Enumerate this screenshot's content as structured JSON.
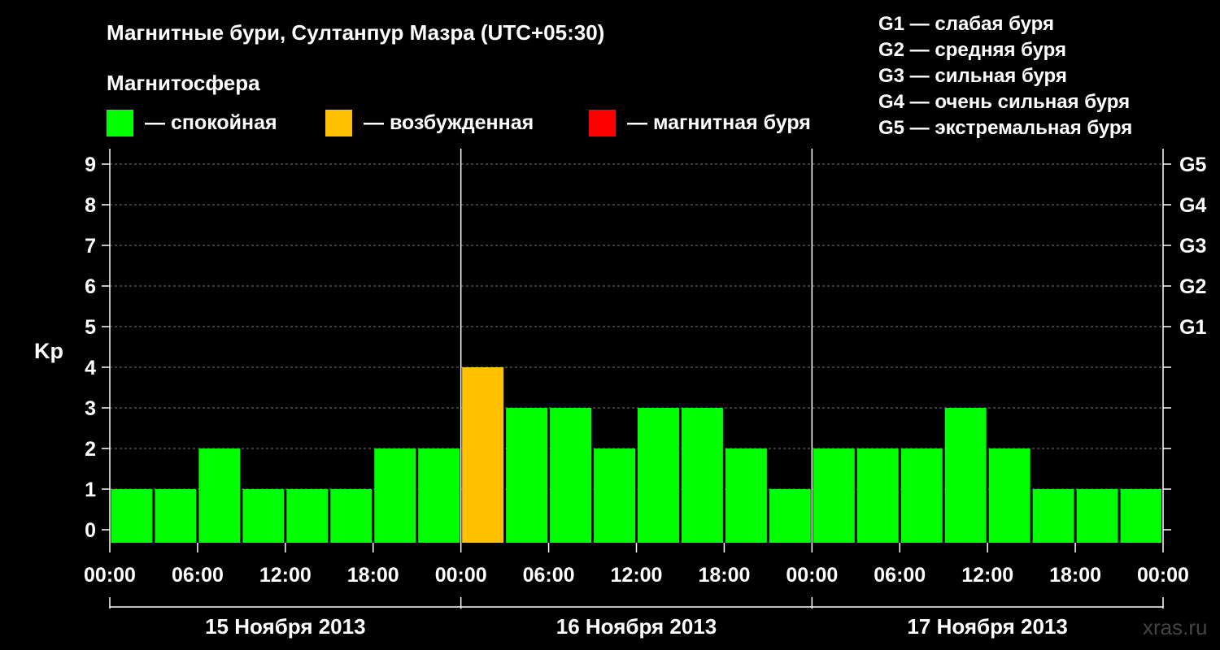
{
  "title": "Магнитные бури, Султанпур Мазра (UTC+05:30)",
  "magnetosphere_label": "Магнитосфера",
  "legend": [
    {
      "color": "#00ff00",
      "label": "— спокойная"
    },
    {
      "color": "#ffc000",
      "label": "— возбужденная"
    },
    {
      "color": "#ff0000",
      "label": "— магнитная буря"
    }
  ],
  "storm_scale": [
    "G1 — слабая буря",
    "G2 — средняя буря",
    "G3 — сильная буря",
    "G4 — очень сильная буря",
    "G5 — экстремальная буря"
  ],
  "watermark": "xras.ru",
  "chart_data": {
    "type": "bar",
    "ylabel": "Kp",
    "ylim": [
      0,
      9
    ],
    "yticks": [
      0,
      1,
      2,
      3,
      4,
      5,
      6,
      7,
      8,
      9
    ],
    "right_ticks": [
      {
        "value": 5,
        "label": "G1"
      },
      {
        "value": 6,
        "label": "G2"
      },
      {
        "value": 7,
        "label": "G3"
      },
      {
        "value": 8,
        "label": "G4"
      },
      {
        "value": 9,
        "label": "G5"
      }
    ],
    "x_tick_labels": [
      "00:00",
      "06:00",
      "12:00",
      "18:00",
      "00:00",
      "06:00",
      "12:00",
      "18:00",
      "00:00",
      "06:00",
      "12:00",
      "18:00",
      "00:00"
    ],
    "days": [
      "15 Ноября 2013",
      "16 Ноября 2013",
      "17 Ноября 2013"
    ],
    "bar_interval_hours": 3,
    "categories": [
      "15.11 03:00",
      "15.11 06:00",
      "15.11 09:00",
      "15.11 12:00",
      "15.11 15:00",
      "15.11 18:00",
      "15.11 21:00",
      "16.11 00:00",
      "16.11 03:00",
      "16.11 06:00",
      "16.11 09:00",
      "16.11 12:00",
      "16.11 15:00",
      "16.11 18:00",
      "16.11 21:00",
      "17.11 00:00",
      "17.11 03:00",
      "17.11 06:00",
      "17.11 09:00",
      "17.11 12:00",
      "17.11 15:00",
      "17.11 18:00",
      "17.11 21:00",
      "18.11 00:00"
    ],
    "values": [
      1,
      1,
      2,
      1,
      1,
      1,
      2,
      2,
      4,
      3,
      3,
      2,
      3,
      3,
      2,
      1,
      2,
      2,
      2,
      3,
      2,
      1,
      1,
      1
    ],
    "colors": {
      "quiet": "#00ff00",
      "active": "#ffc000",
      "storm": "#ff0000"
    },
    "grid": true
  }
}
